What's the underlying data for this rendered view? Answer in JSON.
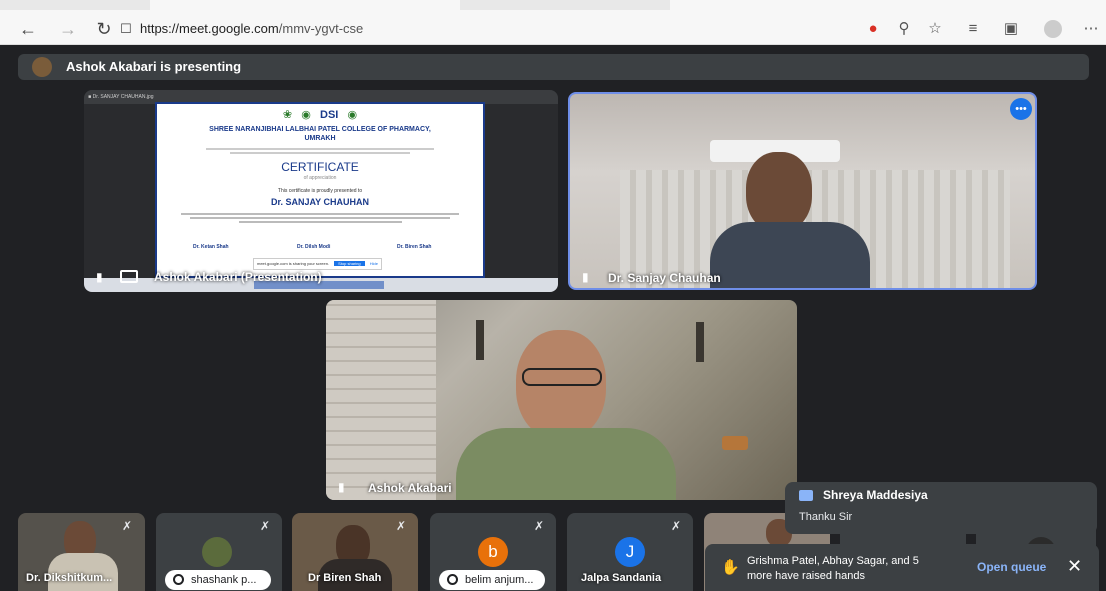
{
  "browser": {
    "url_prefix": "https://meet.google.com",
    "url_path": "/mmv-ygvt-cse",
    "icons": [
      "back-icon",
      "forward-icon",
      "reload-icon",
      "lock-icon",
      "extension-icon",
      "key-icon",
      "add-favorite-icon",
      "favorites-icon",
      "collections-icon",
      "profile-icon",
      "more-icon"
    ]
  },
  "meet": {
    "presenting_banner": "Ashok Akabari is presenting",
    "tiles": {
      "presentation_label": "Ashok Akabari (Presentation)",
      "sanjay_label": "Dr. Sanjay Chauhan",
      "ashok_label": "Ashok Akabari"
    },
    "certificate": {
      "college": "SHREE NARANJIBHAI LALBHAI PATEL COLLEGE OF PHARMACY,",
      "place": "UMRAKH",
      "title": "CERTIFICATE",
      "subtitle": "of appreciation",
      "presented": "This certificate is proudly presented to",
      "recipient": "Dr. SANJAY CHAUHAN",
      "sig1": "Dr. Ketan Shah",
      "sig2": "Dr. Dilsh Modi",
      "sig3": "Dr. Biren Shah",
      "share_notice": "meet.google.com is sharing your screen.",
      "stop_sharing": "Stop sharing",
      "hide": "Hide"
    },
    "strip": [
      {
        "label": "Dr. Dikshitkum..."
      },
      {
        "label": "shashank p..."
      },
      {
        "label": "Dr Biren Shah"
      },
      {
        "label": "belim anjum..."
      },
      {
        "label": "Jalpa Sandania"
      }
    ],
    "letters": {
      "b": "b",
      "j": "J"
    },
    "colors": {
      "b": "#e8710a",
      "j": "#1a73e8"
    },
    "chat_popup": {
      "name": "Shreya Maddesiya",
      "message": "Thanku Sir"
    },
    "hands_popup": {
      "text_line1": "Grishma Patel, Abhay Sagar, and 5",
      "text_line2": "more have raised hands",
      "action": "Open queue"
    }
  }
}
